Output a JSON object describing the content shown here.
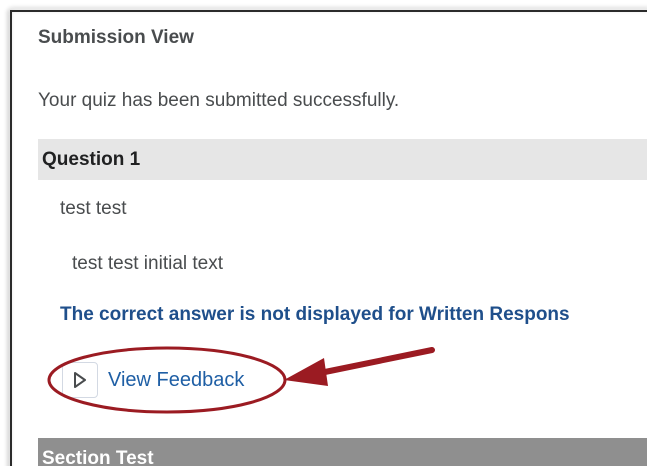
{
  "panel": {
    "title": "Submission View",
    "submitted_message": "Your quiz has been submitted successfully."
  },
  "question": {
    "title": "Question 1",
    "text": "test test",
    "answer": "test test initial text",
    "correct_answer_note": "The correct answer is not displayed for Written Respons",
    "feedback_toggle": {
      "label": "View Feedback",
      "icon": "triangle-right-icon",
      "expanded": false
    }
  },
  "section": {
    "title": "Section Test"
  },
  "colors": {
    "link_blue": "#1f5fa5",
    "note_blue": "#1f4f8b",
    "annotation_red": "#9b1b22",
    "question_header_bg": "#e6e6e6",
    "section_header_bg": "#8f8f8f"
  },
  "annotations": {
    "highlight": "red-ellipse",
    "pointer": "red-arrow"
  }
}
